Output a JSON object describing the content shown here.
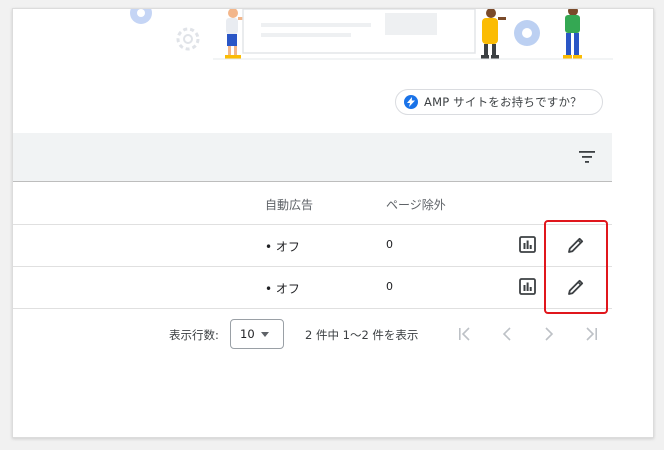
{
  "amp_chip": {
    "label": "AMP サイトをお持ちですか？",
    "icon": "bolt-icon",
    "accent": "#1a73e8"
  },
  "table": {
    "columns": {
      "auto_ads": "自動広告",
      "page_exclusions": "ページ除外"
    },
    "rows": [
      {
        "auto_ads": "• オフ",
        "page_exclusions": "0"
      },
      {
        "auto_ads": "• オフ",
        "page_exclusions": "0"
      }
    ]
  },
  "pagination": {
    "rows_per_page_label": "表示行数:",
    "rows_per_page_value": "10",
    "range_text": "2 件中 1〜2 件を表示"
  },
  "colors": {
    "highlight": "#e0161c",
    "header_bar": "#f1f3f4"
  },
  "icons": [
    "filter-icon",
    "report-icon",
    "edit-pencil-icon",
    "first-page-icon",
    "prev-page-icon",
    "next-page-icon",
    "last-page-icon"
  ]
}
